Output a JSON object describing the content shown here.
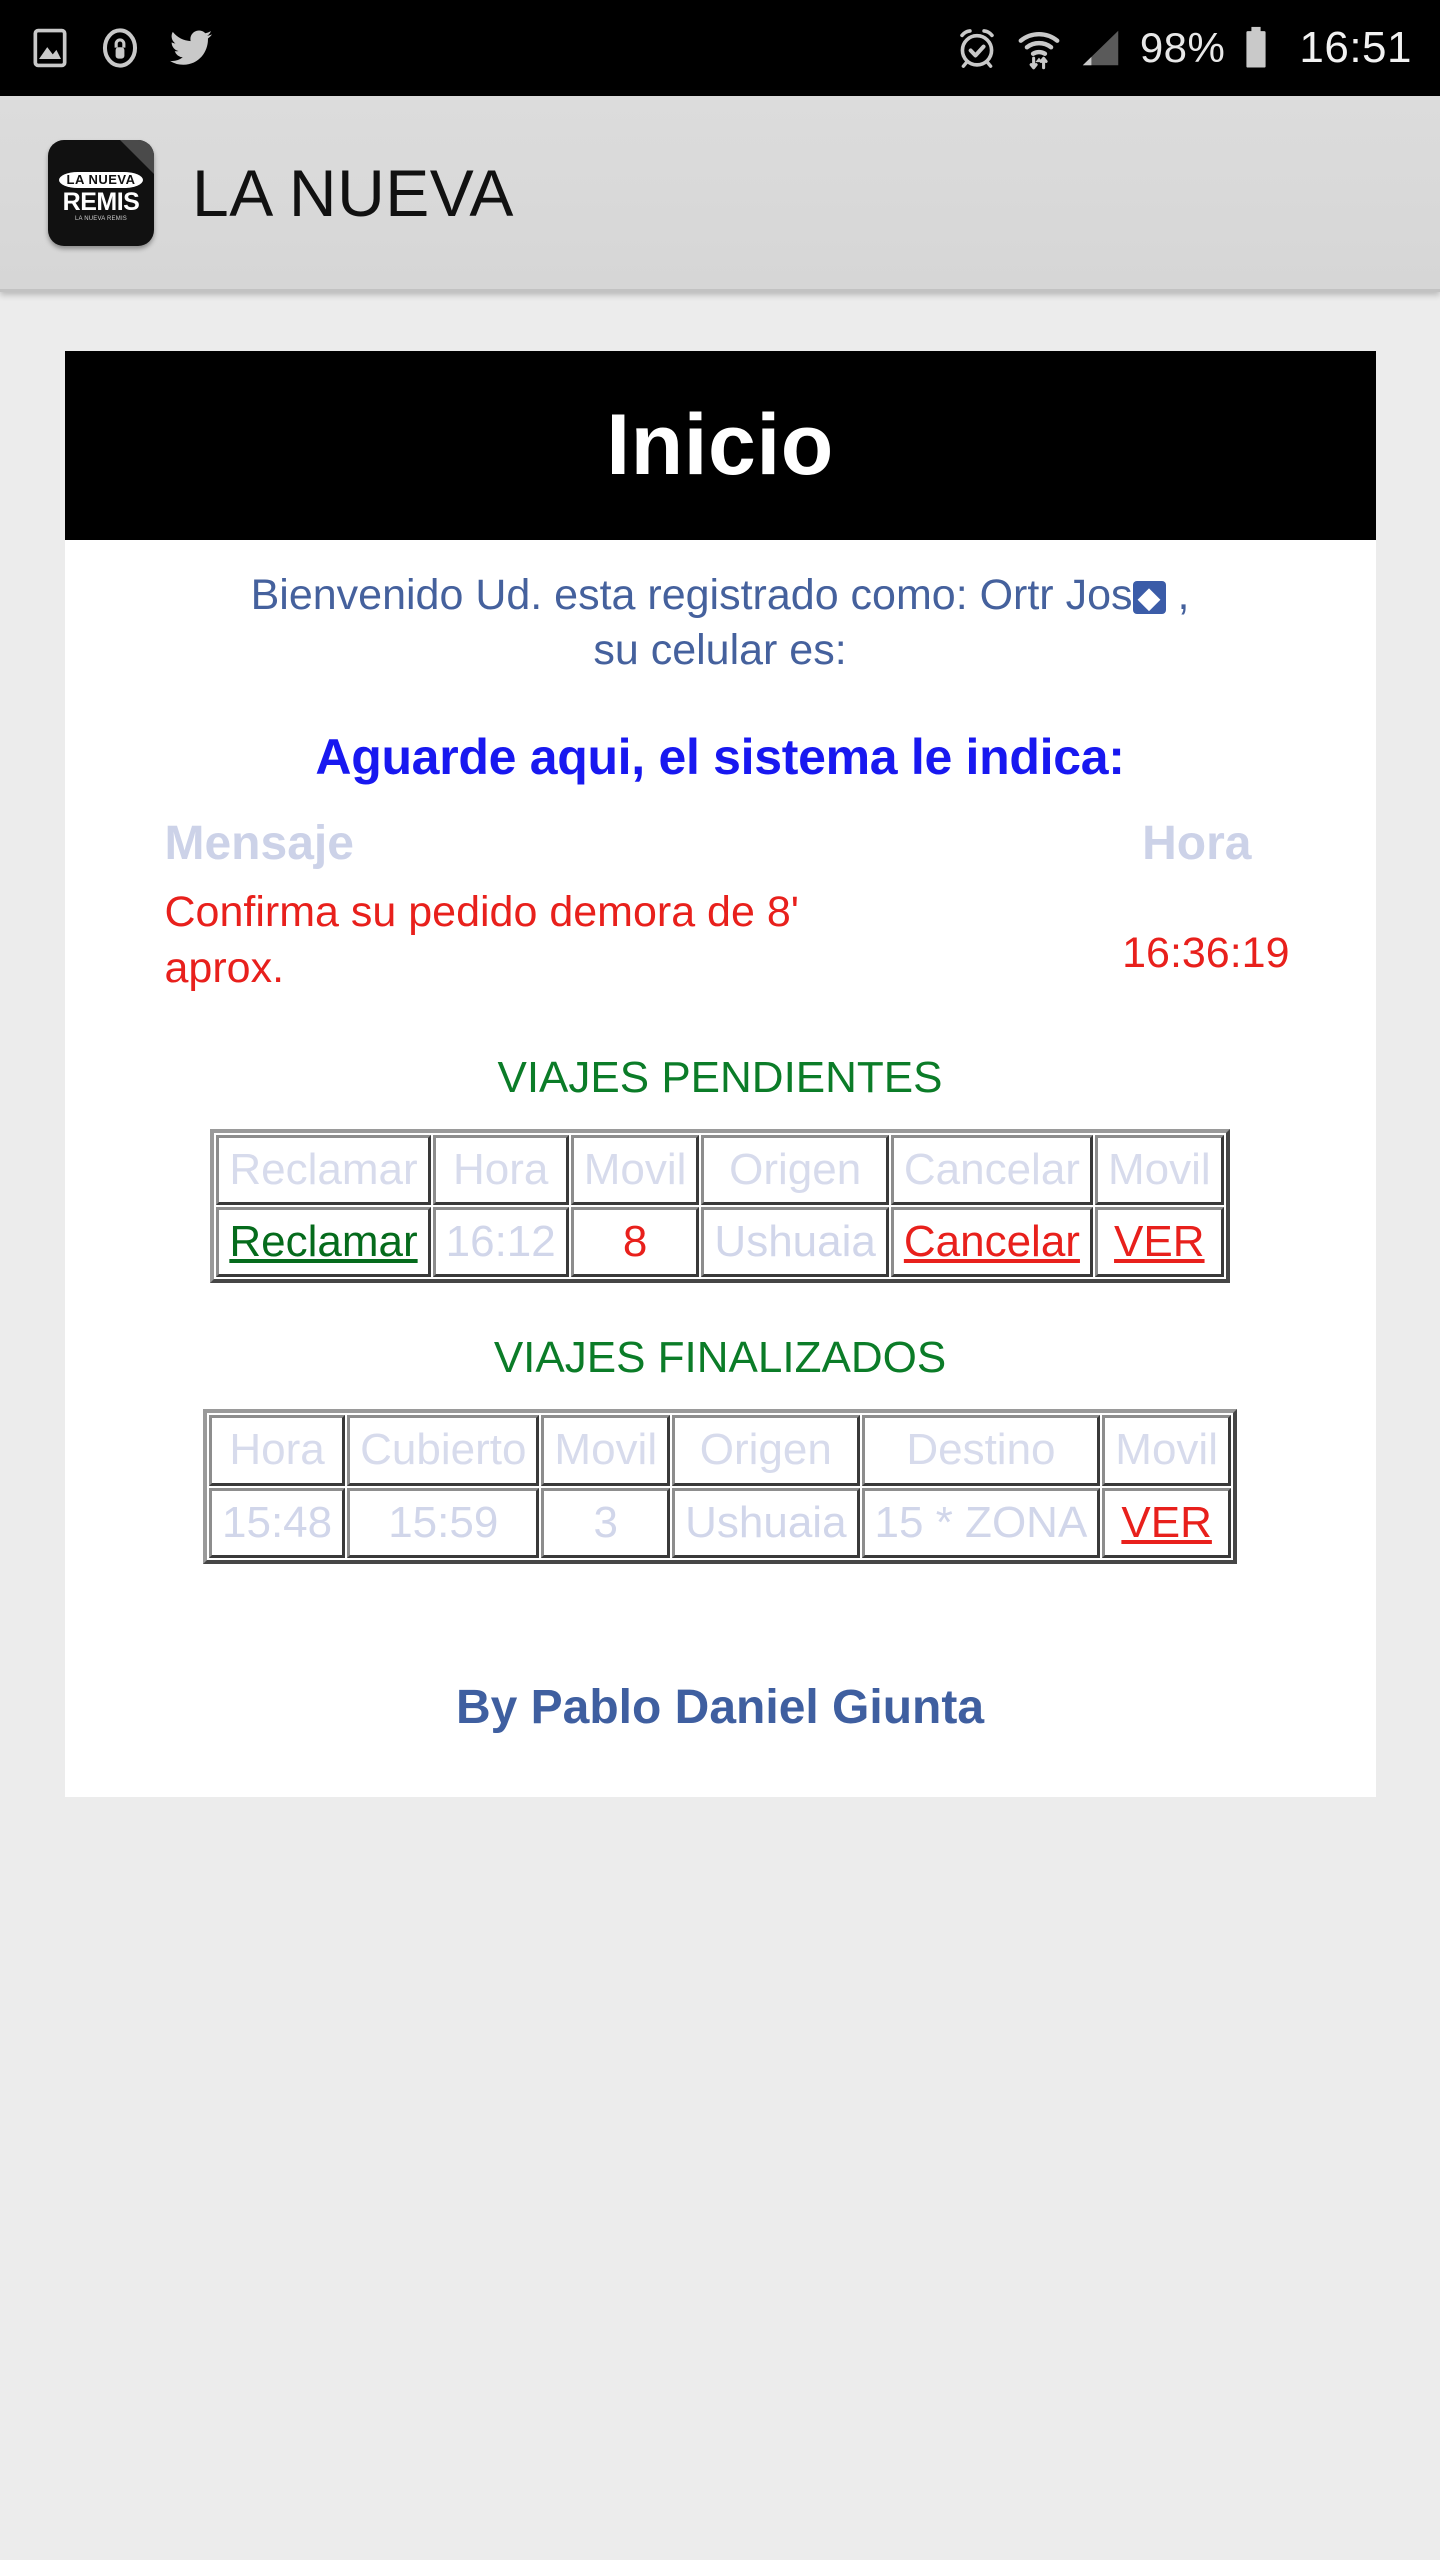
{
  "status_bar": {
    "left_icons": [
      "gallery-icon",
      "lock-icon",
      "twitter-icon"
    ],
    "right_icons": [
      "alarm-icon",
      "wifi-icon",
      "signal-icon",
      "battery-icon"
    ],
    "battery_percent": "98%",
    "clock": "16:51"
  },
  "app_bar": {
    "title": "LA NUEVA",
    "icon_logo_top": "LA NUEVA",
    "icon_logo_main": "REMIS",
    "icon_logo_sub": "LA NUEVA REMIS"
  },
  "content": {
    "banner_title": "Inicio",
    "welcome_prefix": "Bienvenido Ud. esta registrado como: Ortr Jos",
    "welcome_replacement_char": "◆",
    "welcome_suffix": " ,",
    "welcome_line2": "su celular es:",
    "aguarde": "Aguarde aqui, el sistema le indica:",
    "message_header": "Mensaje",
    "hora_header": "Hora",
    "message_text": "Confirma su pedido demora de 8' aprox.",
    "message_time": "16:36:19",
    "pending_title": "VIAJES PENDIENTES",
    "finished_title": "VIAJES FINALIZADOS",
    "footer": "By Pablo Daniel Giunta"
  },
  "pending_table": {
    "headers": [
      "Reclamar",
      "Hora",
      "Movil",
      "Origen",
      "Cancelar",
      "Movil"
    ],
    "rows": [
      {
        "reclamar": "Reclamar",
        "hora": "16:12",
        "movil": "8",
        "origen": "Ushuaia",
        "cancelar": "Cancelar",
        "ver": "VER"
      }
    ]
  },
  "finished_table": {
    "headers": [
      "Hora",
      "Cubierto",
      "Movil",
      "Origen",
      "Destino",
      "Movil"
    ],
    "rows": [
      {
        "hora": "15:48",
        "cubierto": "15:59",
        "movil": "3",
        "origen": "Ushuaia",
        "destino": "15 * ZONA",
        "ver": "VER"
      }
    ]
  },
  "colors": {
    "banner_bg": "#000000",
    "welcome_text": "#45619d",
    "aguarde_text": "#1818f0",
    "table_header_text": "#d7dbec",
    "alert_red": "#e8201c",
    "section_green": "#0b7c28",
    "link_green": "#056b1c",
    "footer_blue": "#3f5fa0"
  }
}
